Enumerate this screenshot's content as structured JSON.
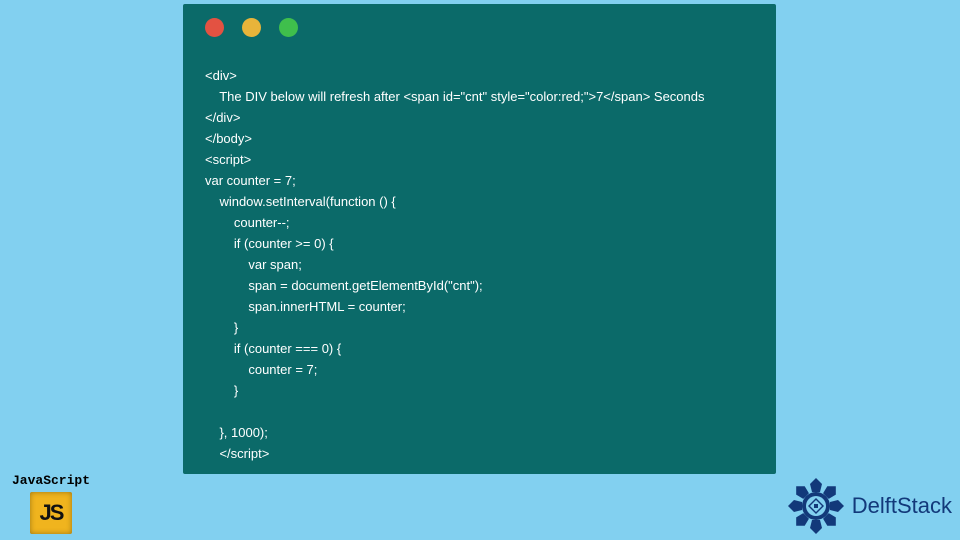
{
  "code": {
    "lines": [
      "<div>",
      "    The DIV below will refresh after <span id=\"cnt\" style=\"color:red;\">7</span> Seconds",
      "</div>",
      "</body>",
      "<script>",
      "var counter = 7;",
      "    window.setInterval(function () {",
      "        counter--;",
      "        if (counter >= 0) {",
      "            var span;",
      "            span = document.getElementById(\"cnt\");",
      "            span.innerHTML = counter;",
      "        }",
      "        if (counter === 0) {",
      "            counter = 7;",
      "        }",
      "",
      "    }, 1000);",
      "    </script>"
    ]
  },
  "js_badge": {
    "label": "JavaScript",
    "tile_text": "JS"
  },
  "delftstack": {
    "name": "DelftStack"
  },
  "colors": {
    "page_bg": "#82d0f0",
    "window_bg": "#0b6a69",
    "dot_red": "#e35242",
    "dot_yellow": "#e8b43a",
    "dot_green": "#3fbf4c",
    "js_tile": "#f0b41e",
    "delft_blue": "#12397a"
  }
}
